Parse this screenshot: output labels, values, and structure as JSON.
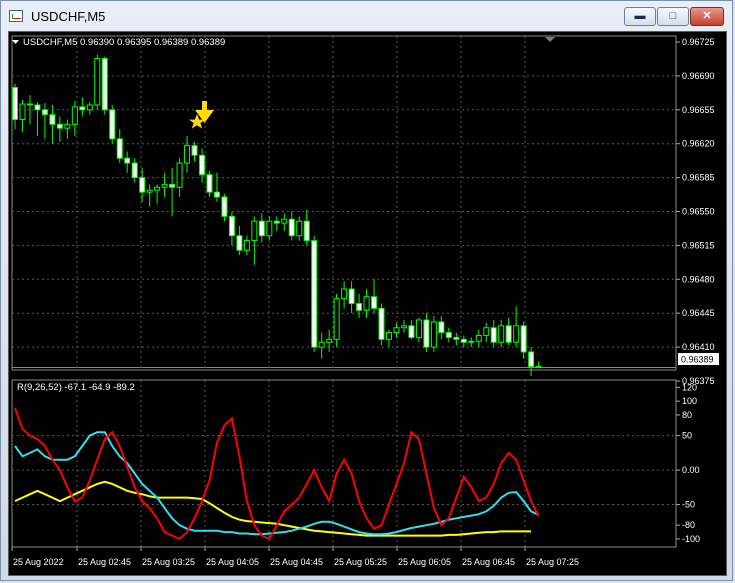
{
  "window": {
    "title": "USDCHF,M5",
    "icon": "chart-window-icon",
    "buttons": {
      "minimize": "▬",
      "maximize": "□",
      "close": "✕"
    }
  },
  "colors": {
    "bull": "#00ff00",
    "bear_fill": "#ffffff",
    "grid": "#5a5a5a",
    "wpr": "#ff0000",
    "fast": "#33ddee",
    "slow": "#ffff00",
    "arrow": "#ffdd00"
  },
  "price_chart": {
    "symbol_info": "USDCHF,M5  0.96390 0.96395 0.96389 0.96389",
    "price_axis": [
      "0.96725",
      "0.96690",
      "0.96655",
      "0.96620",
      "0.96585",
      "0.96550",
      "0.96515",
      "0.96480",
      "0.96445",
      "0.96410",
      "0.96375"
    ],
    "current_price": "0.96389",
    "signal": "sell-arrow-icon"
  },
  "indicator": {
    "label": "R(9,26,52) -67.1 -64.9 -89.2",
    "axis": [
      "120",
      "100",
      "80",
      "50",
      "0.00",
      "-50",
      "-80",
      "-100"
    ]
  },
  "time_axis": [
    "25 Aug 2022",
    "25 Aug 02:45",
    "25 Aug 03:25",
    "25 Aug 04:05",
    "25 Aug 04:45",
    "25 Aug 05:25",
    "25 Aug 06:05",
    "25 Aug 06:45",
    "25 Aug 07:25"
  ],
  "chart_data": {
    "type": "candlestick",
    "symbol": "USDCHF",
    "timeframe": "M5",
    "ylim": [
      0.9637,
      0.9673
    ],
    "candles": [
      {
        "o": 0.96678,
        "h": 0.96682,
        "l": 0.96635,
        "c": 0.96645
      },
      {
        "o": 0.96645,
        "h": 0.96665,
        "l": 0.96632,
        "c": 0.96661
      },
      {
        "o": 0.96661,
        "h": 0.9667,
        "l": 0.9664,
        "c": 0.9666
      },
      {
        "o": 0.9666,
        "h": 0.96663,
        "l": 0.96628,
        "c": 0.96655
      },
      {
        "o": 0.96655,
        "h": 0.96662,
        "l": 0.96625,
        "c": 0.9665
      },
      {
        "o": 0.9665,
        "h": 0.9666,
        "l": 0.9662,
        "c": 0.9664
      },
      {
        "o": 0.9664,
        "h": 0.96648,
        "l": 0.96622,
        "c": 0.96636
      },
      {
        "o": 0.96636,
        "h": 0.96645,
        "l": 0.96625,
        "c": 0.9664
      },
      {
        "o": 0.9664,
        "h": 0.96664,
        "l": 0.96628,
        "c": 0.96658
      },
      {
        "o": 0.96658,
        "h": 0.96668,
        "l": 0.96648,
        "c": 0.96655
      },
      {
        "o": 0.96655,
        "h": 0.96663,
        "l": 0.9665,
        "c": 0.9666
      },
      {
        "o": 0.9666,
        "h": 0.96712,
        "l": 0.96655,
        "c": 0.96708
      },
      {
        "o": 0.96708,
        "h": 0.9671,
        "l": 0.9665,
        "c": 0.96655
      },
      {
        "o": 0.96655,
        "h": 0.9666,
        "l": 0.9662,
        "c": 0.96625
      },
      {
        "o": 0.96625,
        "h": 0.96635,
        "l": 0.966,
        "c": 0.96605
      },
      {
        "o": 0.96605,
        "h": 0.96612,
        "l": 0.9659,
        "c": 0.966
      },
      {
        "o": 0.966,
        "h": 0.96605,
        "l": 0.9658,
        "c": 0.96585
      },
      {
        "o": 0.96585,
        "h": 0.96595,
        "l": 0.9656,
        "c": 0.9657
      },
      {
        "o": 0.9657,
        "h": 0.96578,
        "l": 0.96555,
        "c": 0.96572
      },
      {
        "o": 0.96572,
        "h": 0.96578,
        "l": 0.96558,
        "c": 0.96575
      },
      {
        "o": 0.96575,
        "h": 0.9659,
        "l": 0.96565,
        "c": 0.96578
      },
      {
        "o": 0.96578,
        "h": 0.96595,
        "l": 0.96545,
        "c": 0.96575
      },
      {
        "o": 0.96575,
        "h": 0.96605,
        "l": 0.96565,
        "c": 0.966
      },
      {
        "o": 0.966,
        "h": 0.96628,
        "l": 0.9659,
        "c": 0.96618
      },
      {
        "o": 0.96618,
        "h": 0.96622,
        "l": 0.96602,
        "c": 0.96608
      },
      {
        "o": 0.96608,
        "h": 0.96615,
        "l": 0.9658,
        "c": 0.96588
      },
      {
        "o": 0.96588,
        "h": 0.96592,
        "l": 0.96565,
        "c": 0.9657
      },
      {
        "o": 0.9657,
        "h": 0.9659,
        "l": 0.9656,
        "c": 0.96565
      },
      {
        "o": 0.96565,
        "h": 0.96568,
        "l": 0.9654,
        "c": 0.96545
      },
      {
        "o": 0.96545,
        "h": 0.9655,
        "l": 0.96515,
        "c": 0.96525
      },
      {
        "o": 0.96525,
        "h": 0.96535,
        "l": 0.96505,
        "c": 0.9651
      },
      {
        "o": 0.9651,
        "h": 0.96525,
        "l": 0.96505,
        "c": 0.9652
      },
      {
        "o": 0.9652,
        "h": 0.96545,
        "l": 0.96495,
        "c": 0.9654
      },
      {
        "o": 0.9654,
        "h": 0.96548,
        "l": 0.96518,
        "c": 0.96525
      },
      {
        "o": 0.96525,
        "h": 0.96545,
        "l": 0.9652,
        "c": 0.9654
      },
      {
        "o": 0.9654,
        "h": 0.96545,
        "l": 0.9653,
        "c": 0.96538
      },
      {
        "o": 0.96538,
        "h": 0.96548,
        "l": 0.9653,
        "c": 0.96542
      },
      {
        "o": 0.96542,
        "h": 0.9655,
        "l": 0.9652,
        "c": 0.96525
      },
      {
        "o": 0.96525,
        "h": 0.96545,
        "l": 0.9652,
        "c": 0.9654
      },
      {
        "o": 0.9654,
        "h": 0.96552,
        "l": 0.96515,
        "c": 0.9652
      },
      {
        "o": 0.9652,
        "h": 0.96525,
        "l": 0.96405,
        "c": 0.9641
      },
      {
        "o": 0.9641,
        "h": 0.96425,
        "l": 0.96398,
        "c": 0.96415
      },
      {
        "o": 0.96415,
        "h": 0.96428,
        "l": 0.96405,
        "c": 0.96418
      },
      {
        "o": 0.96418,
        "h": 0.96465,
        "l": 0.9641,
        "c": 0.9646
      },
      {
        "o": 0.9646,
        "h": 0.96478,
        "l": 0.9645,
        "c": 0.9647
      },
      {
        "o": 0.9647,
        "h": 0.96478,
        "l": 0.96445,
        "c": 0.96455
      },
      {
        "o": 0.96455,
        "h": 0.96465,
        "l": 0.9644,
        "c": 0.96448
      },
      {
        "o": 0.96448,
        "h": 0.9647,
        "l": 0.9644,
        "c": 0.96462
      },
      {
        "o": 0.96462,
        "h": 0.9648,
        "l": 0.96445,
        "c": 0.9645
      },
      {
        "o": 0.9645,
        "h": 0.96455,
        "l": 0.96412,
        "c": 0.96418
      },
      {
        "o": 0.96418,
        "h": 0.96428,
        "l": 0.9641,
        "c": 0.96425
      },
      {
        "o": 0.96425,
        "h": 0.96435,
        "l": 0.9642,
        "c": 0.9643
      },
      {
        "o": 0.9643,
        "h": 0.96438,
        "l": 0.96425,
        "c": 0.96432
      },
      {
        "o": 0.96432,
        "h": 0.96438,
        "l": 0.96418,
        "c": 0.9642
      },
      {
        "o": 0.9642,
        "h": 0.9644,
        "l": 0.96415,
        "c": 0.96438
      },
      {
        "o": 0.96438,
        "h": 0.96445,
        "l": 0.96405,
        "c": 0.9641
      },
      {
        "o": 0.9641,
        "h": 0.96442,
        "l": 0.96405,
        "c": 0.96436
      },
      {
        "o": 0.96436,
        "h": 0.96442,
        "l": 0.96418,
        "c": 0.96425
      },
      {
        "o": 0.96425,
        "h": 0.9643,
        "l": 0.96415,
        "c": 0.9642
      },
      {
        "o": 0.9642,
        "h": 0.96425,
        "l": 0.96412,
        "c": 0.96418
      },
      {
        "o": 0.96418,
        "h": 0.96422,
        "l": 0.9641,
        "c": 0.96415
      },
      {
        "o": 0.96415,
        "h": 0.9642,
        "l": 0.9641,
        "c": 0.96416
      },
      {
        "o": 0.96416,
        "h": 0.96428,
        "l": 0.9641,
        "c": 0.96422
      },
      {
        "o": 0.96422,
        "h": 0.96435,
        "l": 0.96415,
        "c": 0.9643
      },
      {
        "o": 0.9643,
        "h": 0.96438,
        "l": 0.9641,
        "c": 0.96415
      },
      {
        "o": 0.96415,
        "h": 0.96438,
        "l": 0.9641,
        "c": 0.96432
      },
      {
        "o": 0.96432,
        "h": 0.9644,
        "l": 0.96412,
        "c": 0.96415
      },
      {
        "o": 0.96415,
        "h": 0.96452,
        "l": 0.9641,
        "c": 0.96432
      },
      {
        "o": 0.96432,
        "h": 0.96436,
        "l": 0.96398,
        "c": 0.96405
      },
      {
        "o": 0.96405,
        "h": 0.9641,
        "l": 0.9638,
        "c": 0.9639
      },
      {
        "o": 0.9639,
        "h": 0.96395,
        "l": 0.96389,
        "c": 0.96389
      }
    ],
    "oscillator": {
      "wpr": [
        90,
        60,
        50,
        45,
        35,
        15,
        0,
        -25,
        -45,
        -40,
        -15,
        15,
        45,
        55,
        35,
        5,
        -25,
        -45,
        -55,
        -70,
        -90,
        -95,
        -100,
        -90,
        -70,
        -45,
        -15,
        40,
        65,
        75,
        20,
        -45,
        -80,
        -95,
        -100,
        -80,
        -60,
        -50,
        -40,
        -20,
        0,
        -25,
        -45,
        -5,
        15,
        -5,
        -45,
        -70,
        -85,
        -80,
        -50,
        -20,
        10,
        55,
        45,
        -5,
        -55,
        -80,
        -70,
        -40,
        -10,
        -25,
        -45,
        -40,
        -20,
        10,
        25,
        15,
        -15,
        -45,
        -67
      ],
      "fast": [
        35,
        20,
        25,
        30,
        20,
        15,
        15,
        15,
        20,
        35,
        50,
        55,
        55,
        35,
        20,
        10,
        -5,
        -20,
        -30,
        -40,
        -55,
        -70,
        -80,
        -85,
        -88,
        -88,
        -88,
        -88,
        -90,
        -90,
        -92,
        -92,
        -93,
        -93,
        -92,
        -91,
        -90,
        -88,
        -85,
        -82,
        -78,
        -75,
        -75,
        -78,
        -82,
        -86,
        -90,
        -92,
        -93,
        -93,
        -92,
        -90,
        -87,
        -84,
        -82,
        -80,
        -78,
        -75,
        -72,
        -70,
        -68,
        -66,
        -64,
        -60,
        -52,
        -40,
        -33,
        -32,
        -45,
        -60,
        -65
      ],
      "slow": [
        -45,
        -40,
        -35,
        -30,
        -35,
        -40,
        -45,
        -40,
        -35,
        -30,
        -25,
        -20,
        -17,
        -20,
        -25,
        -30,
        -33,
        -35,
        -38,
        -40,
        -40,
        -40,
        -40,
        -40,
        -41,
        -42,
        -48,
        -55,
        -62,
        -68,
        -72,
        -74,
        -75,
        -76,
        -77,
        -78,
        -80,
        -82,
        -84,
        -86,
        -88,
        -89,
        -90,
        -91,
        -92,
        -93,
        -94,
        -95,
        -95,
        -95,
        -95,
        -95,
        -95,
        -95,
        -95,
        -95,
        -95,
        -95,
        -94,
        -94,
        -93,
        -92,
        -91,
        -90,
        -90,
        -89,
        -89,
        -89,
        -89,
        -89
      ],
      "ylim": [
        -110,
        125
      ]
    }
  }
}
